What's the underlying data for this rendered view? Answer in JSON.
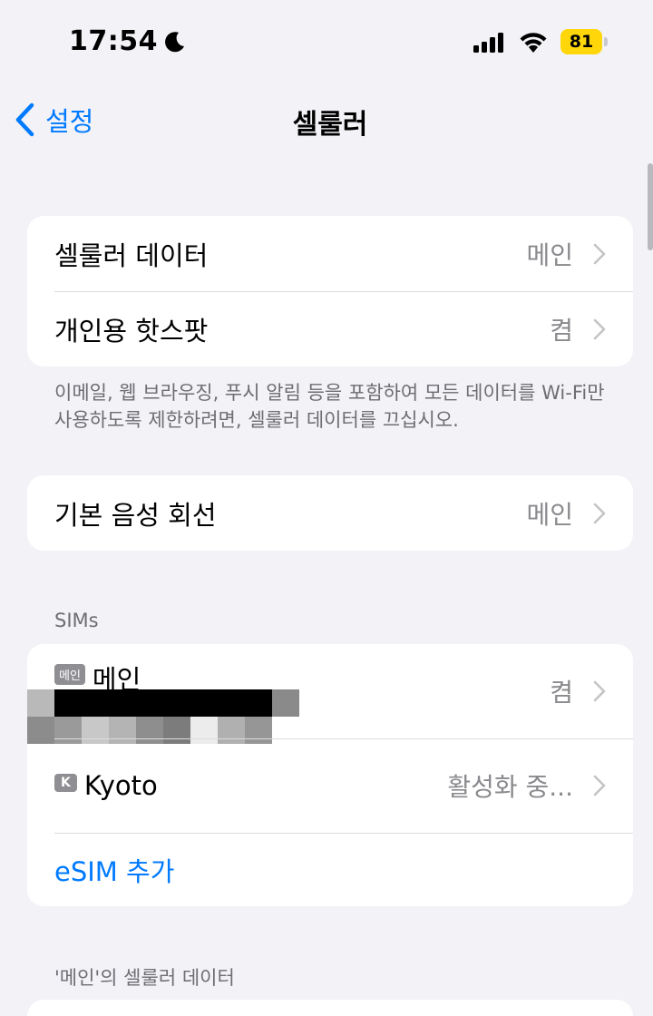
{
  "status_bar": {
    "time": "17:54",
    "battery": "81",
    "battery_color": "#ffd60a"
  },
  "nav": {
    "back_label": "설정",
    "title": "셀룰러",
    "accent_color": "#007aff"
  },
  "group1": {
    "rows": [
      {
        "label": "셀룰러 데이터",
        "value": "메인"
      },
      {
        "label": "개인용 핫스팟",
        "value": "켬"
      }
    ],
    "footer": "이메일, 웹 브라우징, 푸시 알림 등을 포함하여 모든 데이터를 Wi-Fi만 사용하도록 제한하려면, 셀룰러 데이터를 끄십시오."
  },
  "group2": {
    "rows": [
      {
        "label": "기본 음성 회선",
        "value": "메인"
      }
    ]
  },
  "sims": {
    "header": "SIMs",
    "items": [
      {
        "badge": "메인",
        "name": "메인",
        "value": "켬"
      },
      {
        "badge": "K",
        "name": "Kyoto",
        "value": "활성화 중..."
      }
    ],
    "add_label": "eSIM 추가"
  },
  "data_section": {
    "header": "'메인'의 셀룰러 데이터"
  },
  "icons": {
    "moon": "moon-icon",
    "signal": "cellular-signal-icon",
    "wifi": "wifi-icon",
    "back": "chevron-left-icon",
    "chevron": "chevron-right-icon"
  }
}
